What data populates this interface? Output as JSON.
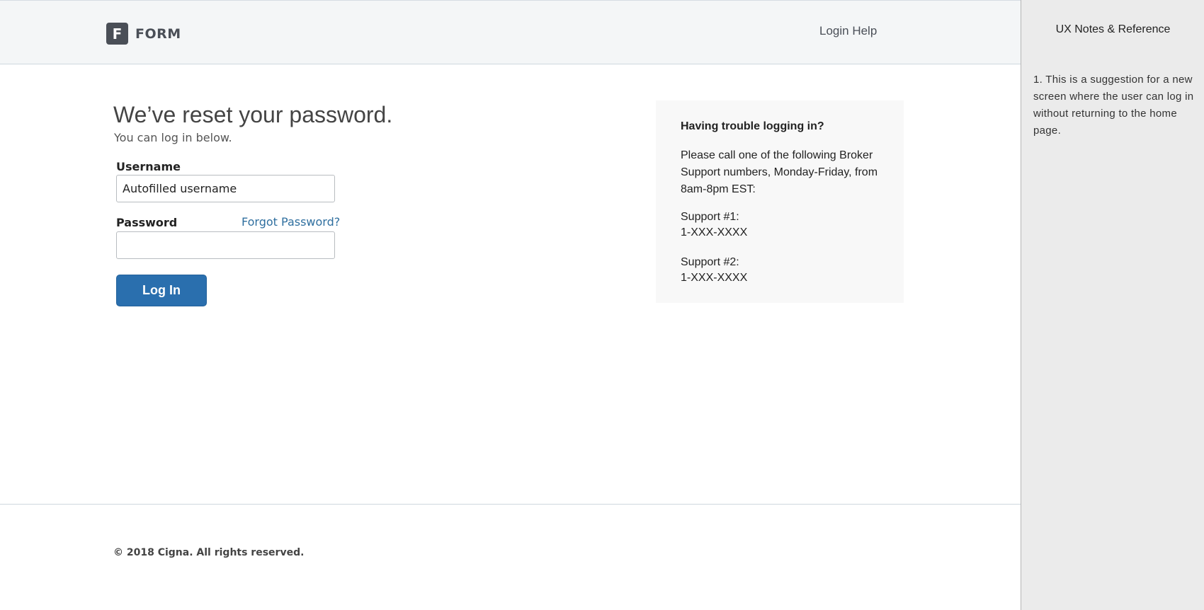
{
  "header": {
    "logo_letter": "F",
    "logo_text": "FORM",
    "login_help": "Login Help"
  },
  "main": {
    "headline": "We’ve reset your password.",
    "subline": "You can log in below.",
    "username_label": "Username",
    "username_value": "Autofilled username",
    "password_label": "Password",
    "password_value": "",
    "forgot_password": "Forgot Password?",
    "login_button": "Log In"
  },
  "help_box": {
    "title": "Having trouble logging in?",
    "body": "Please call one of the following Broker Support numbers, Monday-Friday, from 8am-8pm EST:",
    "support1_label": "Support #1:",
    "support1_number": "1-XXX-XXXX",
    "support2_label": "Support #2:",
    "support2_number": "1-XXX-XXXX"
  },
  "footer": {
    "copyright": "© 2018 Cigna. All rights reserved."
  },
  "notes": {
    "title": "UX Notes & Reference",
    "note1": "1. This is a suggestion for a new screen where the user can log in without returning to the home page."
  },
  "colors": {
    "primary_button": "#2a6fae",
    "link": "#2f6f9f",
    "header_bg": "#f4f6f7",
    "notes_bg": "#ebebeb",
    "help_box_bg": "#f8f8f8"
  }
}
